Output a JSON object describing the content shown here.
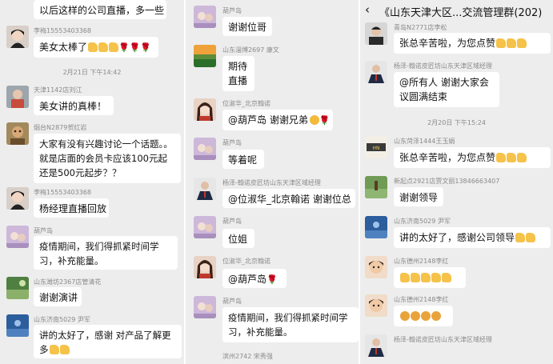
{
  "col1": {
    "msg0_text": "以后这样的公司直播，多一些",
    "msg1_name": "李梅15553403368",
    "msg1_text": "美女太棒了",
    "time1": "2月21日 下午14:42",
    "msg2_name": "天津1142店刘江",
    "msg2_text": "美女讲的真棒！",
    "msg3_name": "烟台N2879贺红岩",
    "msg3_text": "大家有没有兴趣讨论一个话题。。就是店面的会员卡应该100元起还是500元起步？？",
    "msg4_name": "李梅15553403368",
    "msg4_text": "杨经理直播回放",
    "msg5_name": "葫芦岛",
    "msg5_text": "疫情期间，我们得抓紧时间学习，补充能量。",
    "msg6_name": "山东潍坊2367店管清花",
    "msg6_text": "谢谢演讲",
    "msg7_name": "山东济南5029 尹军",
    "msg7_text": "讲的太好了，感谢   对产品了解更多"
  },
  "col2": {
    "msg1_name": "葫芦岛",
    "msg1_text": "谢谢位哥",
    "msg2_name": "山东淄博2697 康文",
    "msg2_text": "期待直播",
    "msg3_name": "位淑华_北京翰诺",
    "msg3_text": "@葫芦岛  谢谢兄弟",
    "msg4_name": "葫芦岛",
    "msg4_text": "等着呢",
    "msg5_name": "杨泽-翰诺皮匠坊山东天津区域经理",
    "msg5_text": "@位淑华_北京翰诺  谢谢位总",
    "msg6_name": "葫芦岛",
    "msg6_text": "位姐",
    "msg7_name": "位淑华_北京翰诺",
    "msg7_text": "@葫芦岛",
    "msg8_name": "葫芦岛",
    "msg8_text": "疫情期间，我们得抓紧时间学习，补充能量。",
    "msg9_name": "滨州2742  宋秀强"
  },
  "col3": {
    "back_icon": "‹",
    "header_title": "《山东天津大区...交流管理群(202)",
    "msg1_name": "青岛N2771店李松",
    "msg1_text": "张总辛苦啦，为您点赞",
    "msg2_name": "杨泽-翰诺皮匠坊山东天津区域经理",
    "msg2_text": "@所有人 谢谢大家会议圆满结束",
    "time1": "2月20日 下午15:24",
    "msg3_name": "山东菏泽1444王玉娟",
    "msg3_text": "张总辛苦啦，为您点赞",
    "msg4_name": "新起点2921店贾文丽13846663407",
    "msg4_text": "谢谢领导",
    "msg5_name": "山东济南5029 尹军",
    "msg5_text": "讲的太好了，感谢公司领导",
    "msg6_name": "山东德州2148李红",
    "msg7_name": "山东德州2148李红",
    "msg8_name": "杨泽-翰诺皮匠坊山东天津区域经理"
  }
}
